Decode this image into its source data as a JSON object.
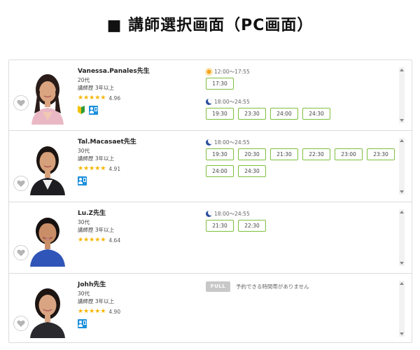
{
  "page_title": "■ 講師選択画面（PC画面）",
  "teachers": [
    {
      "name": "Vanessa.Panales先生",
      "age": "20代",
      "experience": "講師歴  3年以上",
      "rating": "4.96",
      "stars": 4.96,
      "badges": [
        "beginner-mark-icon",
        "teacher-badge-icon"
      ],
      "slot_groups": [
        {
          "period": "sun-icon",
          "range": "12:00〜17:55",
          "times": [
            "17:30"
          ]
        },
        {
          "period": "moon-icon",
          "range": "18:00〜24:55",
          "times": [
            "19:30",
            "23:30",
            "24:00",
            "24:30"
          ]
        }
      ]
    },
    {
      "name": "Tal.Macasaet先生",
      "age": "30代",
      "experience": "講師歴  3年以上",
      "rating": "4.91",
      "stars": 4.91,
      "badges": [
        "teacher-badge-icon"
      ],
      "slot_groups": [
        {
          "period": "moon-icon",
          "range": "18:00〜24:55",
          "times": [
            "19:30",
            "20:30",
            "21:30",
            "22:30",
            "23:00",
            "23:30",
            "24:00",
            "24:30"
          ]
        }
      ]
    },
    {
      "name": "Lu.Z先生",
      "age": "30代",
      "experience": "講師歴  3年以上",
      "rating": "4.64",
      "stars": 4.64,
      "badges": [],
      "slot_groups": [
        {
          "period": "moon-icon",
          "range": "18:00〜24:55",
          "times": [
            "21:30",
            "22:30"
          ]
        }
      ]
    },
    {
      "name": "Johh先生",
      "age": "30代",
      "experience": "講師歴  3年以上",
      "rating": "4.90",
      "stars": 4.9,
      "badges": [
        "teacher-badge-icon"
      ],
      "full_label": "FULL",
      "full_message": "予約できる時間帯がありません",
      "slot_groups": []
    }
  ],
  "colors": {
    "slot_border": "#7fbf3f",
    "star": "#f7b500",
    "badge_blue": "#1a8fdc",
    "full_gray": "#c8c8c8"
  }
}
